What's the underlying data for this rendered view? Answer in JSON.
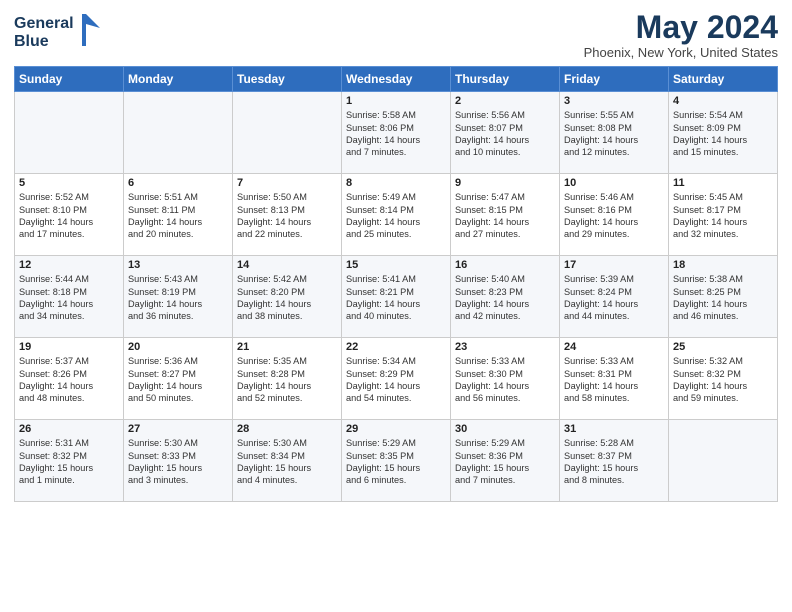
{
  "header": {
    "logo_line1": "General",
    "logo_line2": "Blue",
    "month_title": "May 2024",
    "location": "Phoenix, New York, United States"
  },
  "weekdays": [
    "Sunday",
    "Monday",
    "Tuesday",
    "Wednesday",
    "Thursday",
    "Friday",
    "Saturday"
  ],
  "weeks": [
    [
      {
        "day": "",
        "info": ""
      },
      {
        "day": "",
        "info": ""
      },
      {
        "day": "",
        "info": ""
      },
      {
        "day": "1",
        "info": "Sunrise: 5:58 AM\nSunset: 8:06 PM\nDaylight: 14 hours\nand 7 minutes."
      },
      {
        "day": "2",
        "info": "Sunrise: 5:56 AM\nSunset: 8:07 PM\nDaylight: 14 hours\nand 10 minutes."
      },
      {
        "day": "3",
        "info": "Sunrise: 5:55 AM\nSunset: 8:08 PM\nDaylight: 14 hours\nand 12 minutes."
      },
      {
        "day": "4",
        "info": "Sunrise: 5:54 AM\nSunset: 8:09 PM\nDaylight: 14 hours\nand 15 minutes."
      }
    ],
    [
      {
        "day": "5",
        "info": "Sunrise: 5:52 AM\nSunset: 8:10 PM\nDaylight: 14 hours\nand 17 minutes."
      },
      {
        "day": "6",
        "info": "Sunrise: 5:51 AM\nSunset: 8:11 PM\nDaylight: 14 hours\nand 20 minutes."
      },
      {
        "day": "7",
        "info": "Sunrise: 5:50 AM\nSunset: 8:13 PM\nDaylight: 14 hours\nand 22 minutes."
      },
      {
        "day": "8",
        "info": "Sunrise: 5:49 AM\nSunset: 8:14 PM\nDaylight: 14 hours\nand 25 minutes."
      },
      {
        "day": "9",
        "info": "Sunrise: 5:47 AM\nSunset: 8:15 PM\nDaylight: 14 hours\nand 27 minutes."
      },
      {
        "day": "10",
        "info": "Sunrise: 5:46 AM\nSunset: 8:16 PM\nDaylight: 14 hours\nand 29 minutes."
      },
      {
        "day": "11",
        "info": "Sunrise: 5:45 AM\nSunset: 8:17 PM\nDaylight: 14 hours\nand 32 minutes."
      }
    ],
    [
      {
        "day": "12",
        "info": "Sunrise: 5:44 AM\nSunset: 8:18 PM\nDaylight: 14 hours\nand 34 minutes."
      },
      {
        "day": "13",
        "info": "Sunrise: 5:43 AM\nSunset: 8:19 PM\nDaylight: 14 hours\nand 36 minutes."
      },
      {
        "day": "14",
        "info": "Sunrise: 5:42 AM\nSunset: 8:20 PM\nDaylight: 14 hours\nand 38 minutes."
      },
      {
        "day": "15",
        "info": "Sunrise: 5:41 AM\nSunset: 8:21 PM\nDaylight: 14 hours\nand 40 minutes."
      },
      {
        "day": "16",
        "info": "Sunrise: 5:40 AM\nSunset: 8:23 PM\nDaylight: 14 hours\nand 42 minutes."
      },
      {
        "day": "17",
        "info": "Sunrise: 5:39 AM\nSunset: 8:24 PM\nDaylight: 14 hours\nand 44 minutes."
      },
      {
        "day": "18",
        "info": "Sunrise: 5:38 AM\nSunset: 8:25 PM\nDaylight: 14 hours\nand 46 minutes."
      }
    ],
    [
      {
        "day": "19",
        "info": "Sunrise: 5:37 AM\nSunset: 8:26 PM\nDaylight: 14 hours\nand 48 minutes."
      },
      {
        "day": "20",
        "info": "Sunrise: 5:36 AM\nSunset: 8:27 PM\nDaylight: 14 hours\nand 50 minutes."
      },
      {
        "day": "21",
        "info": "Sunrise: 5:35 AM\nSunset: 8:28 PM\nDaylight: 14 hours\nand 52 minutes."
      },
      {
        "day": "22",
        "info": "Sunrise: 5:34 AM\nSunset: 8:29 PM\nDaylight: 14 hours\nand 54 minutes."
      },
      {
        "day": "23",
        "info": "Sunrise: 5:33 AM\nSunset: 8:30 PM\nDaylight: 14 hours\nand 56 minutes."
      },
      {
        "day": "24",
        "info": "Sunrise: 5:33 AM\nSunset: 8:31 PM\nDaylight: 14 hours\nand 58 minutes."
      },
      {
        "day": "25",
        "info": "Sunrise: 5:32 AM\nSunset: 8:32 PM\nDaylight: 14 hours\nand 59 minutes."
      }
    ],
    [
      {
        "day": "26",
        "info": "Sunrise: 5:31 AM\nSunset: 8:32 PM\nDaylight: 15 hours\nand 1 minute."
      },
      {
        "day": "27",
        "info": "Sunrise: 5:30 AM\nSunset: 8:33 PM\nDaylight: 15 hours\nand 3 minutes."
      },
      {
        "day": "28",
        "info": "Sunrise: 5:30 AM\nSunset: 8:34 PM\nDaylight: 15 hours\nand 4 minutes."
      },
      {
        "day": "29",
        "info": "Sunrise: 5:29 AM\nSunset: 8:35 PM\nDaylight: 15 hours\nand 6 minutes."
      },
      {
        "day": "30",
        "info": "Sunrise: 5:29 AM\nSunset: 8:36 PM\nDaylight: 15 hours\nand 7 minutes."
      },
      {
        "day": "31",
        "info": "Sunrise: 5:28 AM\nSunset: 8:37 PM\nDaylight: 15 hours\nand 8 minutes."
      },
      {
        "day": "",
        "info": ""
      }
    ]
  ]
}
